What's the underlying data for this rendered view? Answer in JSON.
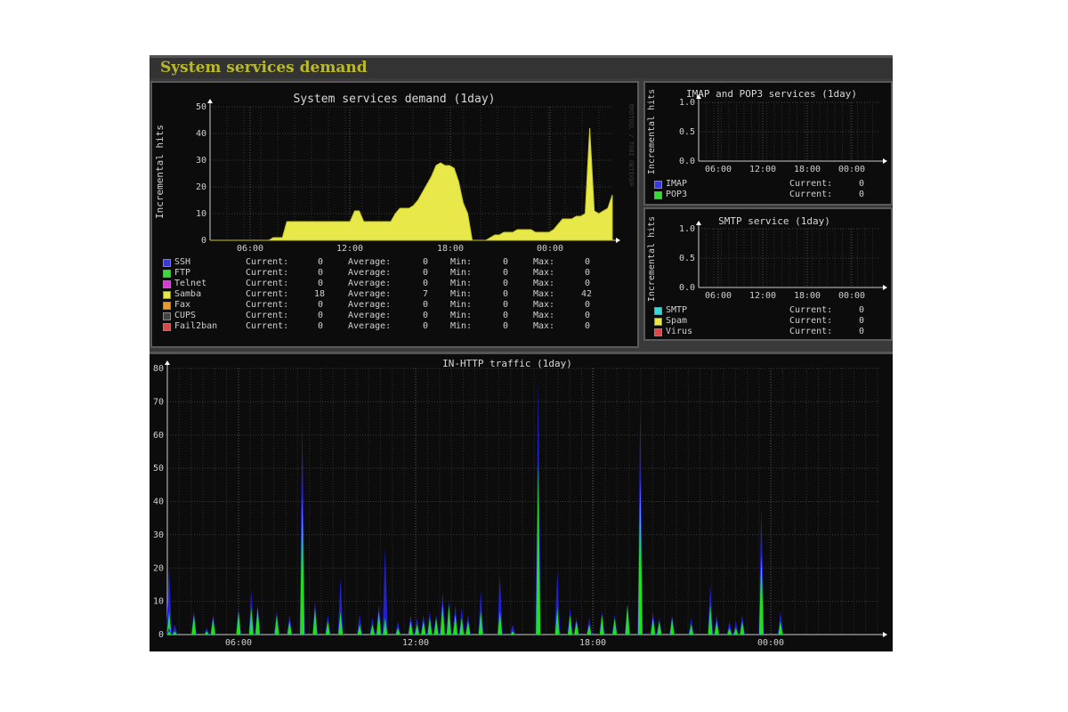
{
  "page_title": "System services demand",
  "main_chart": {
    "title": "System services demand  (1day)",
    "ylabel": "Incremental hits",
    "yticks": [
      "0",
      "10",
      "20",
      "30",
      "40",
      "50"
    ],
    "xticks": [
      "06:00",
      "12:00",
      "18:00",
      "00:00"
    ],
    "watermark": "RRDTOOL / TOBI OETIKER",
    "ymax": 50,
    "fill_color": "#e8e84a",
    "series_samba": [
      0,
      0,
      0,
      0,
      0,
      0,
      0,
      0,
      0,
      0,
      0,
      0,
      0,
      0,
      1,
      1,
      1,
      7,
      7,
      7,
      7,
      7,
      7,
      7,
      7,
      7,
      7,
      7,
      7,
      7,
      7,
      7,
      11,
      11,
      7,
      7,
      7,
      7,
      7,
      7,
      7,
      10,
      12,
      12,
      12,
      13,
      15,
      18,
      21,
      24,
      28,
      29,
      28,
      28,
      27,
      22,
      14,
      10,
      0,
      0,
      0,
      0,
      1,
      2,
      2,
      3,
      3,
      3,
      4,
      4,
      4,
      4,
      3,
      3,
      3,
      3,
      4,
      6,
      8,
      8,
      8,
      9,
      9,
      10,
      42,
      11,
      10,
      11,
      12,
      17
    ],
    "legend_headers": {
      "current": "Current:",
      "average": "Average:",
      "min": "Min:",
      "max": "Max:"
    },
    "legend": [
      {
        "name": "SSH",
        "color": "#3a3ad8",
        "current": "0",
        "average": "0",
        "min": "0",
        "max": "0"
      },
      {
        "name": "FTP",
        "color": "#3ad83a",
        "current": "0",
        "average": "0",
        "min": "0",
        "max": "0"
      },
      {
        "name": "Telnet",
        "color": "#d83ad8",
        "current": "0",
        "average": "0",
        "min": "0",
        "max": "0"
      },
      {
        "name": "Samba",
        "color": "#e8e84a",
        "current": "18",
        "average": "7",
        "min": "0",
        "max": "42"
      },
      {
        "name": "Fax",
        "color": "#e89a2a",
        "current": "0",
        "average": "0",
        "min": "0",
        "max": "0"
      },
      {
        "name": "CUPS",
        "color": "#444444",
        "current": "0",
        "average": "0",
        "min": "0",
        "max": "0"
      },
      {
        "name": "Fail2ban",
        "color": "#d84a4a",
        "current": "0",
        "average": "0",
        "min": "0",
        "max": "0"
      }
    ]
  },
  "imap_chart": {
    "title": "IMAP and POP3 services  (1day)",
    "ylabel": "Incremental hits",
    "yticks": [
      "0.0",
      "0.5",
      "1.0"
    ],
    "xticks": [
      "06:00",
      "12:00",
      "18:00",
      "00:00"
    ],
    "current_label": "Current:",
    "legend": [
      {
        "name": "IMAP",
        "color": "#3a3ad8",
        "current": "0"
      },
      {
        "name": "POP3",
        "color": "#3ad83a",
        "current": "0"
      }
    ]
  },
  "smtp_chart": {
    "title": "SMTP service  (1day)",
    "ylabel": "Incremental hits",
    "yticks": [
      "0.0",
      "0.5",
      "1.0"
    ],
    "xticks": [
      "06:00",
      "12:00",
      "18:00",
      "00:00"
    ],
    "current_label": "Current:",
    "legend": [
      {
        "name": "SMTP",
        "color": "#3ad8d8",
        "current": "0"
      },
      {
        "name": "Spam",
        "color": "#e8e84a",
        "current": "0"
      },
      {
        "name": "Virus",
        "color": "#d84a4a",
        "current": "0"
      }
    ]
  },
  "http_chart": {
    "title": "IN-HTTP traffic  (1day)",
    "yticks": [
      "0",
      "10",
      "20",
      "30",
      "40",
      "50",
      "60",
      "70",
      "80"
    ],
    "xticks": [
      "06:00",
      "12:00",
      "18:00",
      "00:00"
    ],
    "ymax": 80,
    "blue_color": "#2020d8",
    "green_color": "#22dd22",
    "spikes": [
      [
        0.05,
        17,
        6
      ],
      [
        0.06,
        20,
        7
      ],
      [
        0.1,
        2,
        1
      ],
      [
        0.12,
        3,
        1
      ],
      [
        0.15,
        7,
        6
      ],
      [
        0.17,
        2,
        1
      ],
      [
        0.18,
        6,
        5
      ],
      [
        0.22,
        8,
        7
      ],
      [
        0.24,
        13,
        8
      ],
      [
        0.25,
        9,
        8
      ],
      [
        0.28,
        7,
        6
      ],
      [
        0.3,
        6,
        4
      ],
      [
        0.32,
        64,
        42
      ],
      [
        0.34,
        10,
        8
      ],
      [
        0.36,
        6,
        4
      ],
      [
        0.38,
        17,
        7
      ],
      [
        0.41,
        6,
        3
      ],
      [
        0.43,
        5,
        3
      ],
      [
        0.44,
        9,
        7
      ],
      [
        0.45,
        26,
        5
      ],
      [
        0.47,
        4,
        2
      ],
      [
        0.49,
        6,
        4
      ],
      [
        0.5,
        5,
        3
      ],
      [
        0.51,
        6,
        4
      ],
      [
        0.52,
        7,
        5
      ],
      [
        0.53,
        6,
        5
      ],
      [
        0.54,
        13,
        9
      ],
      [
        0.55,
        10,
        9
      ],
      [
        0.56,
        9,
        6
      ],
      [
        0.57,
        8,
        5
      ],
      [
        0.58,
        6,
        4
      ],
      [
        0.6,
        13,
        7
      ],
      [
        0.63,
        18,
        7
      ],
      [
        0.65,
        3,
        1
      ],
      [
        0.69,
        76,
        52
      ],
      [
        0.72,
        19,
        8
      ],
      [
        0.74,
        8,
        6
      ],
      [
        0.75,
        5,
        4
      ],
      [
        0.77,
        5,
        3
      ],
      [
        0.79,
        7,
        6
      ],
      [
        0.81,
        6,
        5
      ],
      [
        0.83,
        9,
        9
      ],
      [
        0.85,
        68,
        47
      ],
      [
        0.87,
        7,
        5
      ],
      [
        0.88,
        5,
        4
      ],
      [
        0.9,
        6,
        5
      ],
      [
        0.93,
        5,
        3
      ],
      [
        0.96,
        15,
        9
      ],
      [
        0.97,
        6,
        4
      ],
      [
        0.99,
        4,
        2
      ],
      [
        1.0,
        4,
        2
      ],
      [
        1.01,
        6,
        4
      ],
      [
        1.04,
        38,
        24
      ],
      [
        1.07,
        7,
        4
      ]
    ]
  }
}
